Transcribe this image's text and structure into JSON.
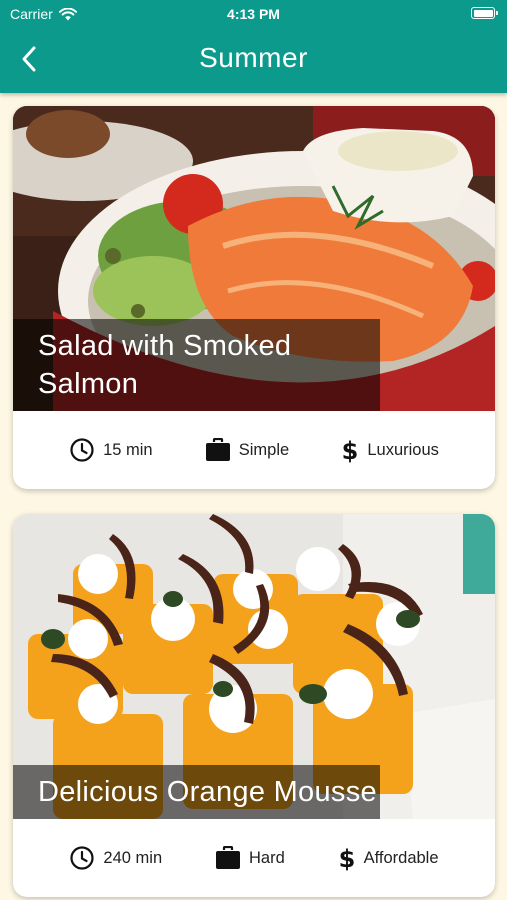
{
  "status_bar": {
    "carrier": "Carrier",
    "time": "4:13 PM"
  },
  "header": {
    "title": "Summer",
    "back_icon": "chevron-left-icon"
  },
  "colors": {
    "app_bar": "#0b9a8b",
    "background": "#fdf7e3"
  },
  "meals": [
    {
      "title": "Salad with Smoked Salmon",
      "duration": "15 min",
      "complexity": "Simple",
      "affordability": "Luxurious"
    },
    {
      "title": "Delicious Orange Mousse",
      "duration": "240 min",
      "complexity": "Hard",
      "affordability": "Affordable"
    }
  ]
}
